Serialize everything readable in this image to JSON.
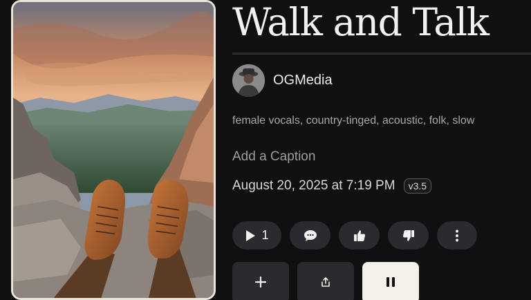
{
  "song": {
    "title": "Walk and Talk",
    "artist": "OGMedia",
    "tags": "female vocals, country-tinged, acoustic, folk, slow",
    "caption_placeholder": "Add a Caption",
    "date": "August 20, 2025 at 7:19 PM",
    "version": "v3.5"
  },
  "actions": {
    "play_count": "1",
    "icons": {
      "play": "play-icon",
      "comment": "comment-icon",
      "like": "thumbs-up-icon",
      "dislike": "thumbs-down-icon",
      "more": "more-vertical-icon",
      "add": "plus-icon",
      "share": "share-icon",
      "pause": "pause-icon"
    }
  },
  "colors": {
    "background": "#101012",
    "pill": "#2b2b2f",
    "pause_button": "#f3f1ea"
  }
}
